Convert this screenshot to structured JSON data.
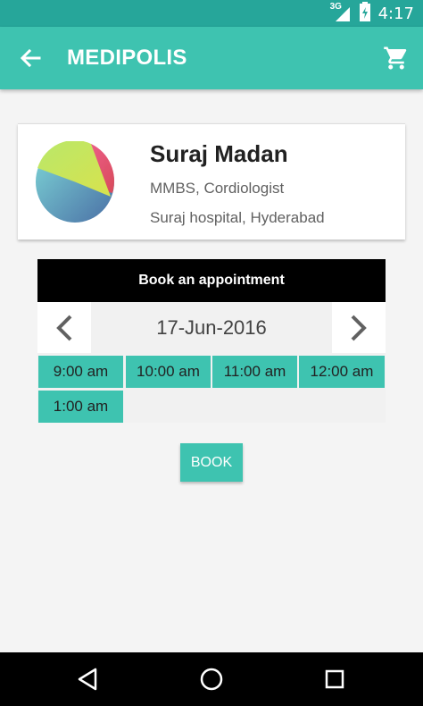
{
  "status_bar": {
    "network": "3G",
    "time": "4:17"
  },
  "app_bar": {
    "title": "MEDIPOLIS",
    "back_icon": "arrow-back-icon",
    "cart_icon": "shopping-cart-icon"
  },
  "doctor": {
    "name": "Suraj Madan",
    "qualification": "MMBS, Cordiologist",
    "location": "Suraj hospital, Hyderabad"
  },
  "booking": {
    "header": "Book an appointment",
    "date": "17-Jun-2016",
    "slots": [
      "9:00 am",
      "10:00 am",
      "11:00 am",
      "12:00 am",
      "1:00 am"
    ]
  },
  "book_button": "BOOK",
  "colors": {
    "primary": "#3ec3b0",
    "primary_dark": "#26a69a"
  }
}
